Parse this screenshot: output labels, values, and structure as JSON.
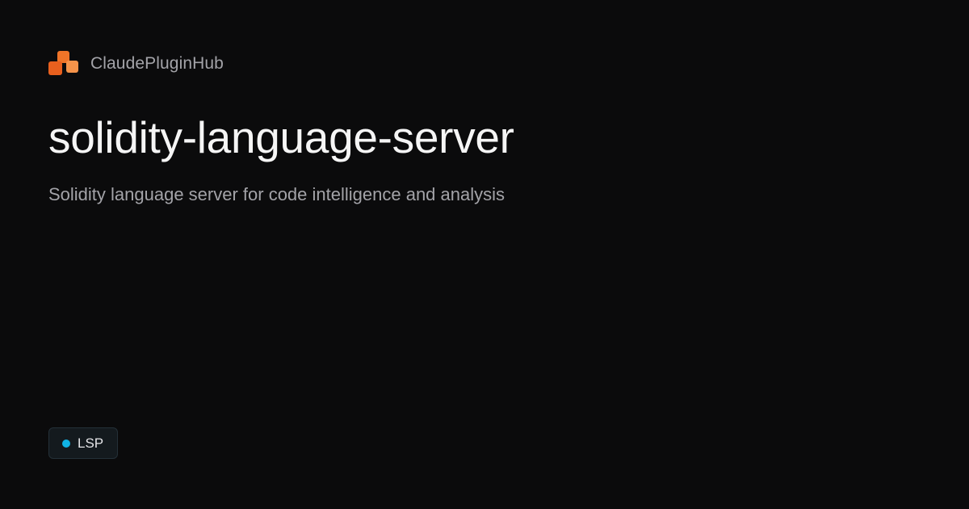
{
  "brand": {
    "name": "ClaudePluginHub",
    "logo_icon": "stacked-blocks-icon",
    "accent_color": "#f07428"
  },
  "plugin": {
    "title": "solidity-language-server",
    "description": "Solidity language server for code intelligence and analysis"
  },
  "tag": {
    "label": "LSP",
    "dot_color": "#10b4e6"
  }
}
